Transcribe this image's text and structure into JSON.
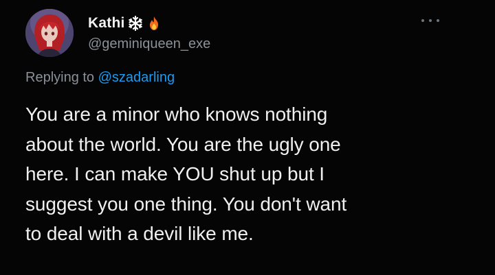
{
  "user": {
    "display_name": "Kathi",
    "handle": "@geminiqueen_exe",
    "emojis": [
      "snowflake-icon",
      "fire-icon"
    ]
  },
  "reply_context": {
    "prefix": "Replying to",
    "mention": "@szadarling"
  },
  "tweet": {
    "lines": [
      "You are a minor who knows nothing",
      "about the world. You are the ugly one",
      "here. I can make YOU shut up but I",
      "suggest you one thing. You don't want",
      "to deal with a devil like me."
    ]
  },
  "colors": {
    "background": "#050505",
    "text": "#f0f0f0",
    "secondary": "#8b9198",
    "accent": "#1d9bf0"
  },
  "icons": {
    "more": "more-horizontal-icon",
    "avatar": "avatar-image"
  }
}
